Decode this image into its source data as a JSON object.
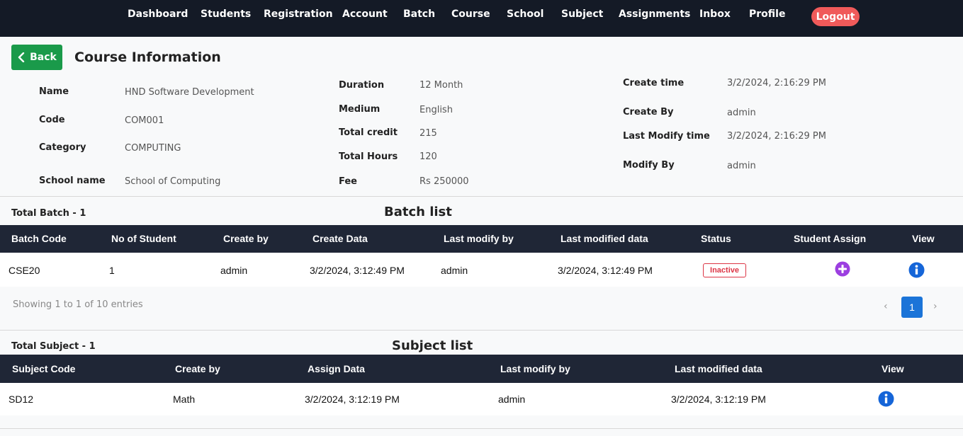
{
  "nav": {
    "items": [
      "Dashboard",
      "Students",
      "Registration",
      "Account",
      "Batch",
      "Course",
      "School",
      "Subject",
      "Assignments",
      "Inbox",
      "Profile"
    ],
    "logout": "Logout"
  },
  "header": {
    "back": "Back",
    "title": "Course Information"
  },
  "course": {
    "name_label": "Name",
    "name": "HND Software Development",
    "code_label": "Code",
    "code": "COM001",
    "category_label": "Category",
    "category": "COMPUTING",
    "school_label": "School name",
    "school": "School of Computing",
    "duration_label": "Duration",
    "duration": "12 Month",
    "medium_label": "Medium",
    "medium": "English",
    "credit_label": "Total credit",
    "credit": "215",
    "hours_label": "Total Hours",
    "hours": "120",
    "fee_label": "Fee",
    "fee": "Rs 250000",
    "create_time_label": "Create time",
    "create_time": "3/2/2024, 2:16:29 PM",
    "create_by_label": "Create By",
    "create_by": "admin",
    "modify_time_label": "Last Modify time",
    "modify_time": "3/2/2024, 2:16:29 PM",
    "modify_by_label": "Modify By",
    "modify_by": "admin"
  },
  "batch": {
    "total": "Total Batch - 1",
    "title": "Batch list",
    "headers": [
      "Batch Code",
      "No of Student",
      "Create by",
      "Create Data",
      "Last modify by",
      "Last modified data",
      "Status",
      "Student Assign",
      "View"
    ],
    "rows": [
      {
        "code": "CSE20",
        "students": "1",
        "create_by": "admin",
        "create_date": "3/2/2024, 3:12:49 PM",
        "modify_by": "admin",
        "modify_date": "3/2/2024, 3:12:49 PM",
        "status": "Inactive"
      }
    ],
    "showing": "Showing 1 to 1 of 10 entries",
    "pager": {
      "prev": "‹",
      "page": "1",
      "next": "›"
    }
  },
  "subject": {
    "total": "Total Subject - 1",
    "title": "Subject list",
    "headers": [
      "Subject Code",
      "Create by",
      "Assign Data",
      "Last modify by",
      "Last modified data",
      "View"
    ],
    "rows": [
      {
        "code": "SD12",
        "create_by": "Math",
        "assign_date": "3/2/2024, 3:12:19 PM",
        "modify_by": "admin",
        "modify_date": "3/2/2024, 3:12:19 PM"
      }
    ]
  },
  "colors": {
    "navbar": "#141a26",
    "table_header": "#1f2636",
    "back_button": "#1a9a4a",
    "logout": "#f05a5a",
    "info_icon": "#1565d8",
    "assign_icon": "#9c3fe0",
    "inactive": "#dc3545",
    "active_page": "#1b74d8"
  },
  "icons": {
    "back": "chevron-left-icon",
    "assign": "plus-circle-icon",
    "view": "info-circle-icon"
  }
}
